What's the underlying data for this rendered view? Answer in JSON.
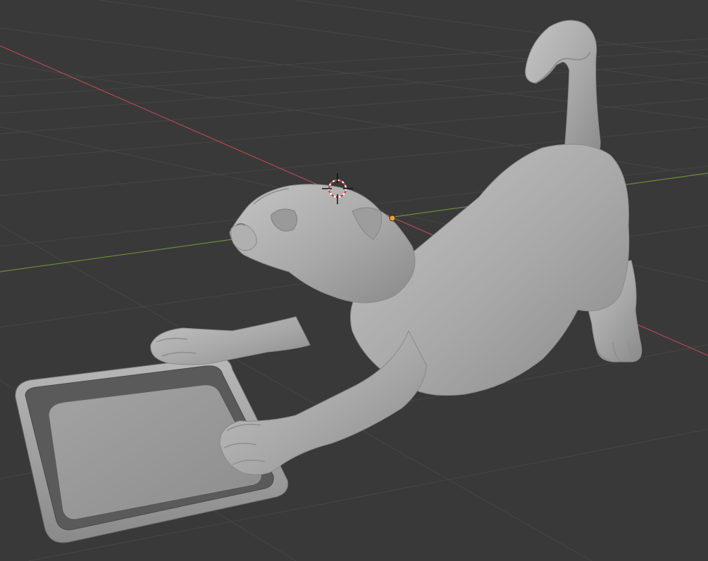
{
  "viewport": {
    "background_color": "#393939",
    "grid_color": "#4a4a4a",
    "x_axis_color": "#b3494f",
    "y_axis_color": "#6b8c3a",
    "mesh_color": "#a9a9a9",
    "mesh_shadow_color": "#7c7c7c",
    "mesh_highlight_color": "#c9c9c9",
    "origin_color": "#f3a12a"
  },
  "scene": {
    "object_name": "cat-with-tray",
    "icons": {
      "cursor": "3d-cursor-icon",
      "origin": "object-origin-icon"
    }
  }
}
